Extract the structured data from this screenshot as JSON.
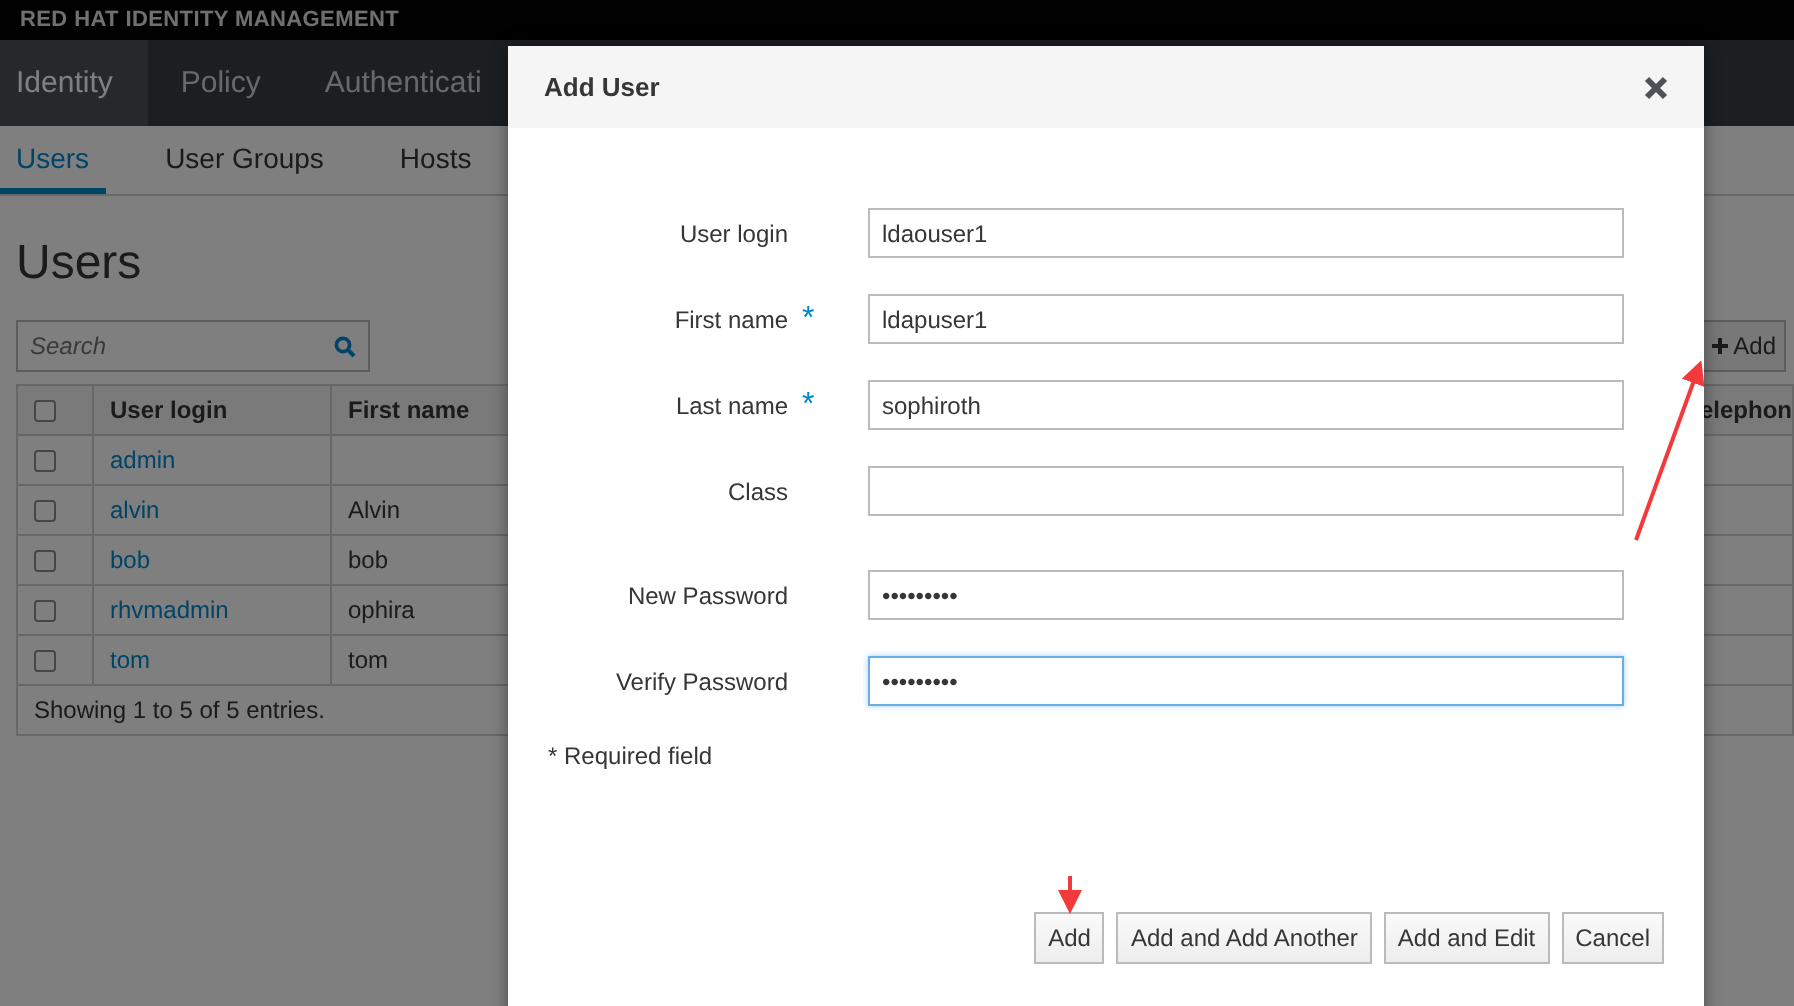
{
  "brand": "RED HAT IDENTITY MANAGEMENT",
  "nav_tabs": [
    {
      "label": "Identity",
      "selected": true
    },
    {
      "label": "Policy",
      "selected": false
    },
    {
      "label": "Authenticati",
      "selected": false
    }
  ],
  "sub_tabs": [
    {
      "label": "Users",
      "selected": true
    },
    {
      "label": "User Groups",
      "selected": false
    },
    {
      "label": "Hosts",
      "selected": false
    }
  ],
  "page_title": "Users",
  "search": {
    "placeholder": "Search"
  },
  "add_button": "Add",
  "table": {
    "select_all_checked": false,
    "columns": [
      "User login",
      "First name",
      "elephon"
    ],
    "rows": [
      {
        "checked": false,
        "cells": [
          "admin"
        ]
      },
      {
        "checked": false,
        "cells": [
          "alvin",
          "Alvin"
        ]
      },
      {
        "checked": false,
        "cells": [
          "bob",
          "bob"
        ]
      },
      {
        "checked": false,
        "cells": [
          "rhvmadmin",
          "ophira"
        ]
      },
      {
        "checked": false,
        "cells": [
          "tom",
          "tom"
        ]
      }
    ],
    "footer": "Showing 1 to 5 of 5 entries."
  },
  "dialog": {
    "title": "Add User",
    "field_groups": [
      [
        {
          "label": "User login",
          "value": "ldaouser1",
          "focused": false
        },
        {
          "label": "First name",
          "required_mark": "*",
          "value": "ldapuser1",
          "focused": false
        },
        {
          "label": "Last name",
          "required_mark": "*",
          "value": "sophiroth",
          "focused": false
        },
        {
          "label": "Class",
          "focused": false
        }
      ],
      [
        {
          "label": "New Password",
          "value": "•••••••••",
          "focused": false
        },
        {
          "label": "Verify Password",
          "value": "•••••••••",
          "focused": true
        }
      ]
    ],
    "required_note": "* Required field",
    "buttons": [
      "Add",
      "Add and Add Another",
      "Add and Edit",
      "Cancel"
    ]
  }
}
